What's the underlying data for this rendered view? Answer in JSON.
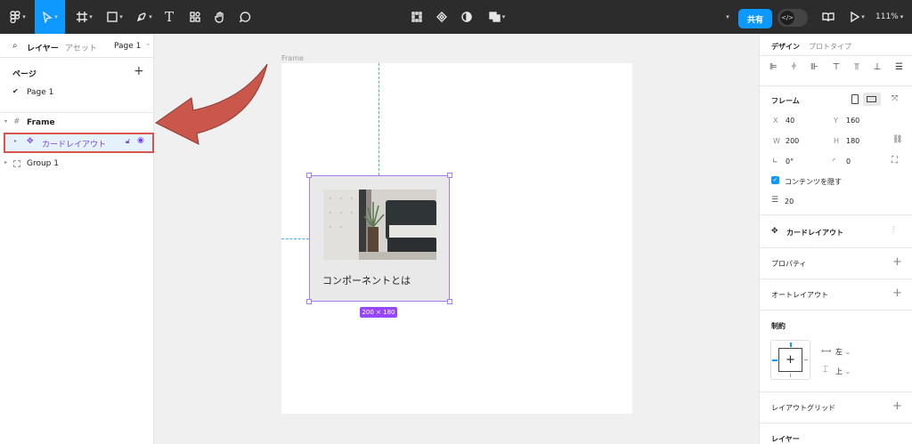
{
  "toolbar": {
    "tools": [
      "main-menu",
      "move",
      "frame",
      "shape",
      "pen",
      "text",
      "resources",
      "hand",
      "comment"
    ],
    "text_tool_glyph": "T",
    "share_label": "共有",
    "zoom": "111%",
    "accent": "#0d99ff"
  },
  "left_panel": {
    "tab_layers": "レイヤー",
    "tab_assets": "アセット",
    "page_selector": "Page 1",
    "pages_heading": "ページ",
    "pages": [
      {
        "label": "Page 1",
        "checked": true
      }
    ],
    "layers": [
      {
        "label": "Frame",
        "icon": "frame-icon"
      },
      {
        "label": "カードレイアウト",
        "icon": "component-icon",
        "selected": true
      },
      {
        "label": "Group 1",
        "icon": "group-icon"
      }
    ]
  },
  "canvas": {
    "frame_label": "Frame",
    "card_title": "コンポーネントとは",
    "size_badge": "200 × 180",
    "selection_color": "#9747ff",
    "annotation_arrow_color": "#c9574b"
  },
  "right_panel": {
    "tab_design": "デザイン",
    "tab_prototype": "プロトタイプ",
    "frame_section": "フレーム",
    "x_label": "X",
    "x_value": "40",
    "y_label": "Y",
    "y_value": "160",
    "w_label": "W",
    "w_value": "200",
    "h_label": "H",
    "h_value": "180",
    "rotation": "0°",
    "radius": "0",
    "clip_content_label": "コンテンツを隠す",
    "clip_content_checked": true,
    "spacing_value": "20",
    "component_name": "カードレイアウト",
    "properties": "プロパティ",
    "auto_layout": "オートレイアウト",
    "constraints": "制約",
    "constraint_h": "左",
    "constraint_v": "上",
    "layout_grid": "レイアウトグリッド",
    "layer": "レイヤー"
  }
}
